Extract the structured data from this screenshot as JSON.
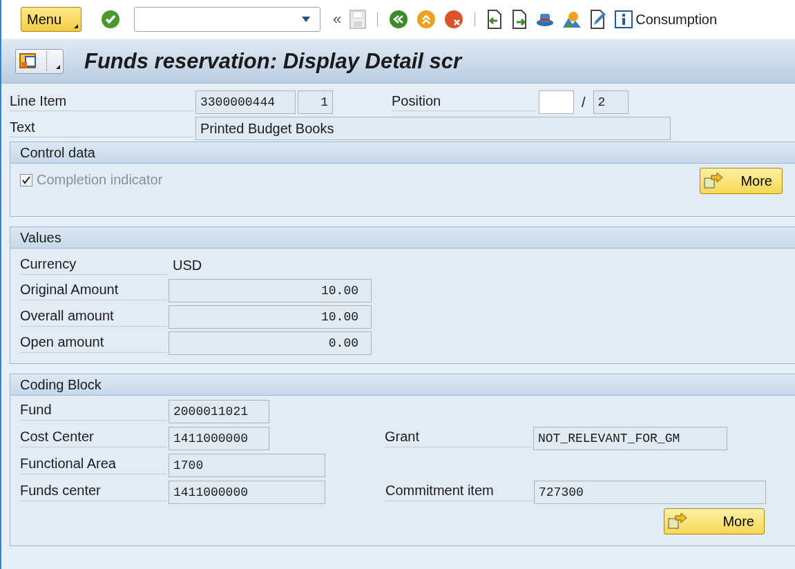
{
  "toolbar": {
    "menu": "Menu",
    "back": "«",
    "consumption": "Consumption"
  },
  "title": "Funds reservation: Display Detail scr",
  "header": {
    "line_item": {
      "label": "Line Item",
      "document": "3300000444",
      "item": "1"
    },
    "position": {
      "label": "Position",
      "separator": "/",
      "total": "2"
    },
    "text": {
      "label": "Text",
      "value": "Printed Budget Books"
    }
  },
  "control_data": {
    "title": "Control data",
    "completion": {
      "label": "Completion indicator",
      "checked": true,
      "disabled": true
    },
    "more": "More"
  },
  "values": {
    "title": "Values",
    "rows": [
      {
        "kind": "text",
        "label": "Currency",
        "value": "USD"
      },
      {
        "kind": "amount",
        "label": "Original Amount",
        "value": "10.00"
      },
      {
        "kind": "amount",
        "label": "Overall amount",
        "value": "10.00"
      },
      {
        "kind": "amount",
        "label": "Open amount",
        "value": "0.00"
      }
    ]
  },
  "coding_block": {
    "title": "Coding Block",
    "more": "More",
    "rows": [
      {
        "label": "Fund",
        "value": "2000011021"
      },
      {
        "label": "Cost Center",
        "value": "1411000000",
        "side": {
          "label": "Grant",
          "value": "NOT_RELEVANT_FOR_GM"
        }
      },
      {
        "label": "Functional Area",
        "value": "1700"
      },
      {
        "label": "Funds center",
        "value": "1411000000",
        "side": {
          "label": "Commitment item",
          "value": "727300"
        }
      }
    ]
  }
}
